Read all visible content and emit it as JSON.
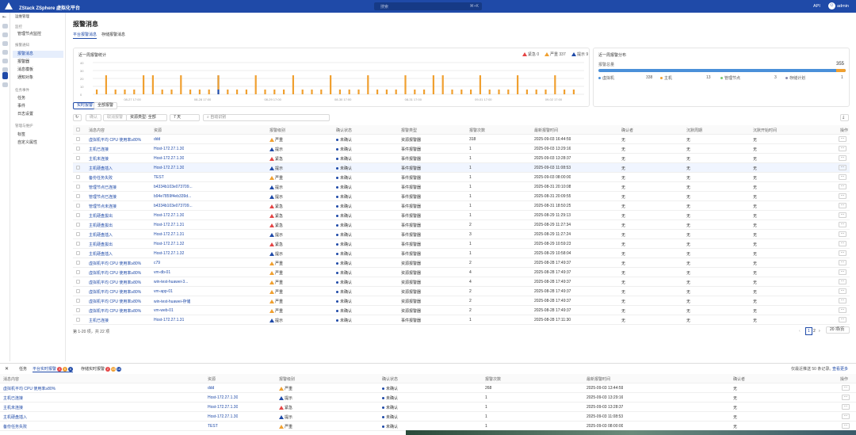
{
  "app": {
    "title": "ZStack ZSphere 虚拟化平台",
    "search_placeholder": "搜索",
    "search_shortcut": "⌘+K",
    "api": "API",
    "user": "admin"
  },
  "sidebar": {
    "section_ops": "运维管理",
    "group1": "监控",
    "item_node": "管理节点监控",
    "group2": "报警通知",
    "items2": [
      "报警消息",
      "报警器",
      "消息模板",
      "通知对象"
    ],
    "group3": "任务事件",
    "items3": [
      "任务",
      "事件",
      "日志设置"
    ],
    "group4": "管理与维护",
    "items4": [
      "标签",
      "自定义属性"
    ]
  },
  "page": {
    "title": "报警消息",
    "tabs": [
      "平台报警消息",
      "存储报警消息"
    ]
  },
  "chart": {
    "title": "近一周报警统计",
    "legend": [
      {
        "label": "紧急 0",
        "color": "#e54545"
      },
      {
        "label": "严重 337",
        "color": "#f0a030"
      },
      {
        "label": "提示 9",
        "color": "#1f4aa8"
      }
    ]
  },
  "chart_data": {
    "type": "bar",
    "title": "近一周报警统计",
    "y_ticks": [
      40,
      30,
      20,
      10,
      0
    ],
    "x_ticks": [
      "08-27 17:00",
      "08-28 17:00",
      "08-29 17:00",
      "08-30 17:00",
      "08-31 17:00",
      "09-01 17:00",
      "09-02 17:00"
    ],
    "series": [
      {
        "name": "紧急",
        "values": []
      },
      {
        "name": "严重",
        "values": []
      },
      {
        "name": "提示",
        "values": []
      }
    ]
  },
  "dist": {
    "title": "近一周报警分布",
    "label": "报警总量",
    "total": "355",
    "items": [
      {
        "label": "虚拟机",
        "value": "338"
      },
      {
        "label": "主机",
        "value": "13"
      },
      {
        "label": "管理节点",
        "value": "3"
      },
      {
        "label": "存储计划",
        "value": "1"
      }
    ]
  },
  "subtabs": [
    "实时报警",
    "全部报警"
  ],
  "toolbar": {
    "confirm": "确认",
    "unconfirm": "取消报警",
    "resource": "资源类型: 全部",
    "days": "7 天",
    "filter": "自动识别"
  },
  "table": {
    "headers": [
      "消息内容",
      "资源",
      "报警级别",
      "确认状态",
      "报警类型",
      "报警次数",
      "最新报警时间",
      "确认者",
      "沉默周期",
      "沉默开始时间",
      "操作"
    ],
    "rows": [
      [
        "虚拟机平均 CPU 使用率≥80%",
        "ddd",
        "严重",
        "未确认",
        "资源报警器",
        "318",
        "2025-09-03 16:44:59",
        "无",
        "无",
        "无"
      ],
      [
        "主机已连接",
        "Host-172.27.1.30",
        "提示",
        "未确认",
        "事件报警器",
        "1",
        "2025-09-03 13:29:16",
        "无",
        "无",
        "无"
      ],
      [
        "主机未连接",
        "Host-172.27.1.30",
        "紧急",
        "未确认",
        "事件报警器",
        "1",
        "2025-09-03 13:28:37",
        "无",
        "无",
        "无"
      ],
      [
        "主机硬盘插入",
        "Host-172.27.1.30",
        "提示",
        "未确认",
        "事件报警器",
        "1",
        "2025-09-03 11:08:53",
        "无",
        "无",
        "无"
      ],
      [
        "备份任务失败",
        "TEST",
        "严重",
        "未确认",
        "事件报警器",
        "1",
        "2025-09-03 08:00:00",
        "无",
        "无",
        "无"
      ],
      [
        "管理节点已连接",
        "b4334b103e073709...",
        "提示",
        "未确认",
        "事件报警器",
        "1",
        "2025-08-31 20:10:08",
        "无",
        "无",
        "无"
      ],
      [
        "管理节点已连接",
        "b94e7859f4eb339d...",
        "提示",
        "未确认",
        "事件报警器",
        "1",
        "2025-08-31 20:09:55",
        "无",
        "无",
        "无"
      ],
      [
        "管理节点未连接",
        "b4334b103e073709...",
        "紧急",
        "未确认",
        "事件报警器",
        "1",
        "2025-08-31 18:50:25",
        "无",
        "无",
        "无"
      ],
      [
        "主机硬盘拔出",
        "Host-172.27.1.30",
        "紧急",
        "未确认",
        "事件报警器",
        "1",
        "2025-08-29 11:29:13",
        "无",
        "无",
        "无"
      ],
      [
        "主机硬盘拔出",
        "Host-172.27.1.31",
        "紧急",
        "未确认",
        "事件报警器",
        "2",
        "2025-08-29 11:27:34",
        "无",
        "无",
        "无"
      ],
      [
        "主机硬盘插入",
        "Host-172.27.1.31",
        "提示",
        "未确认",
        "事件报警器",
        "3",
        "2025-08-29 11:27:24",
        "无",
        "无",
        "无"
      ],
      [
        "主机硬盘拔出",
        "Host-172.27.1.32",
        "紧急",
        "未确认",
        "事件报警器",
        "1",
        "2025-08-29 10:59:23",
        "无",
        "无",
        "无"
      ],
      [
        "主机硬盘插入",
        "Host-172.27.1.32",
        "提示",
        "未确认",
        "事件报警器",
        "1",
        "2025-08-29 10:58:04",
        "无",
        "无",
        "无"
      ],
      [
        "虚拟机平均 CPU 使用率≥80%",
        "c79",
        "严重",
        "未确认",
        "资源报警器",
        "2",
        "2025-08-28 17:49:37",
        "无",
        "无",
        "无"
      ],
      [
        "虚拟机平均 CPU 使用率≥80%",
        "vm-db-01",
        "严重",
        "未确认",
        "资源报警器",
        "4",
        "2025-08-28 17:49:37",
        "无",
        "无",
        "无"
      ],
      [
        "虚拟机平均 CPU 使用率≥80%",
        "win-test-huawei-3...",
        "严重",
        "未确认",
        "资源报警器",
        "4",
        "2025-08-28 17:49:37",
        "无",
        "无",
        "无"
      ],
      [
        "虚拟机平均 CPU 使用率≥80%",
        "vm-app-01",
        "严重",
        "未确认",
        "资源报警器",
        "2",
        "2025-08-28 17:49:37",
        "无",
        "无",
        "无"
      ],
      [
        "虚拟机平均 CPU 使用率≥80%",
        "win-test-huawei-存储",
        "严重",
        "未确认",
        "资源报警器",
        "2",
        "2025-08-28 17:49:37",
        "无",
        "无",
        "无"
      ],
      [
        "虚拟机平均 CPU 使用率≥80%",
        "vm-web-01",
        "严重",
        "未确认",
        "资源报警器",
        "2",
        "2025-08-28 17:49:37",
        "无",
        "无",
        "无"
      ],
      [
        "主机已连接",
        "Host-172.27.1.31",
        "提示",
        "未确认",
        "事件报警器",
        "1",
        "2025-08-28 17:11:30",
        "无",
        "无",
        "无"
      ]
    ]
  },
  "pager": {
    "summary": "第 1-20 项，共 22 项",
    "pages": [
      "1",
      "2"
    ],
    "size": "20 项/页"
  },
  "bottom": {
    "tabs": [
      "任务",
      "平台实时报警",
      "存储实时报警"
    ],
    "badges1": [
      "3",
      "6",
      "6"
    ],
    "badges2": [
      "2",
      "15",
      "16"
    ],
    "note": "仅最近推送 50 条记录。",
    "more": "查看更多",
    "headers": [
      "消息内容",
      "资源",
      "报警级别",
      "确认状态",
      "报警次数",
      "最新报警时间",
      "确认者",
      "操作"
    ],
    "rows": [
      [
        "虚拟机平均 CPU 使用率≥80%",
        "ddd",
        "严重",
        "未确认",
        "268",
        "2025-09-03 13:44:59",
        "无"
      ],
      [
        "主机已连接",
        "Host-172.27.1.30",
        "提示",
        "未确认",
        "1",
        "2025-09-03 13:29:16",
        "无"
      ],
      [
        "主机未连接",
        "Host-172.27.1.30",
        "紧急",
        "未确认",
        "1",
        "2025-09-03 13:28:37",
        "无"
      ],
      [
        "主机硬盘插入",
        "Host-172.27.1.30",
        "提示",
        "未确认",
        "1",
        "2025-09-03 11:08:53",
        "无"
      ],
      [
        "备份任务失败",
        "TEST",
        "严重",
        "未确认",
        "1",
        "2025-09-03 08:00:00",
        "无"
      ]
    ]
  }
}
